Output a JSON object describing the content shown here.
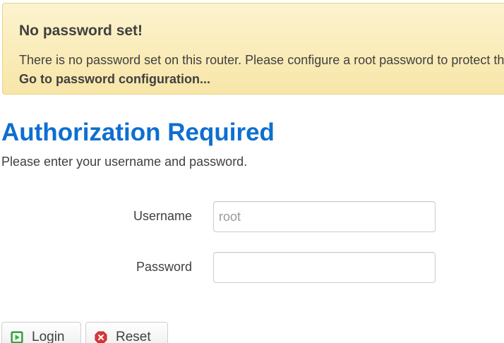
{
  "alert": {
    "title": "No password set!",
    "text": "There is no password set on this router. Please configure a root password to protect the web interface.",
    "link": "Go to password configuration..."
  },
  "auth": {
    "title": "Authorization Required",
    "description": "Please enter your username and password."
  },
  "form": {
    "username_label": "Username",
    "username_placeholder": "root",
    "username_value": "",
    "password_label": "Password",
    "password_value": ""
  },
  "buttons": {
    "login_label": "Login",
    "reset_label": "Reset"
  },
  "icons": {
    "login": "login-icon",
    "reset": "reset-icon"
  },
  "colors": {
    "accent": "#0d6fd0",
    "alert_background": "#f8e6a8",
    "login_icon": "#3cb043",
    "reset_icon": "#d9383a"
  }
}
